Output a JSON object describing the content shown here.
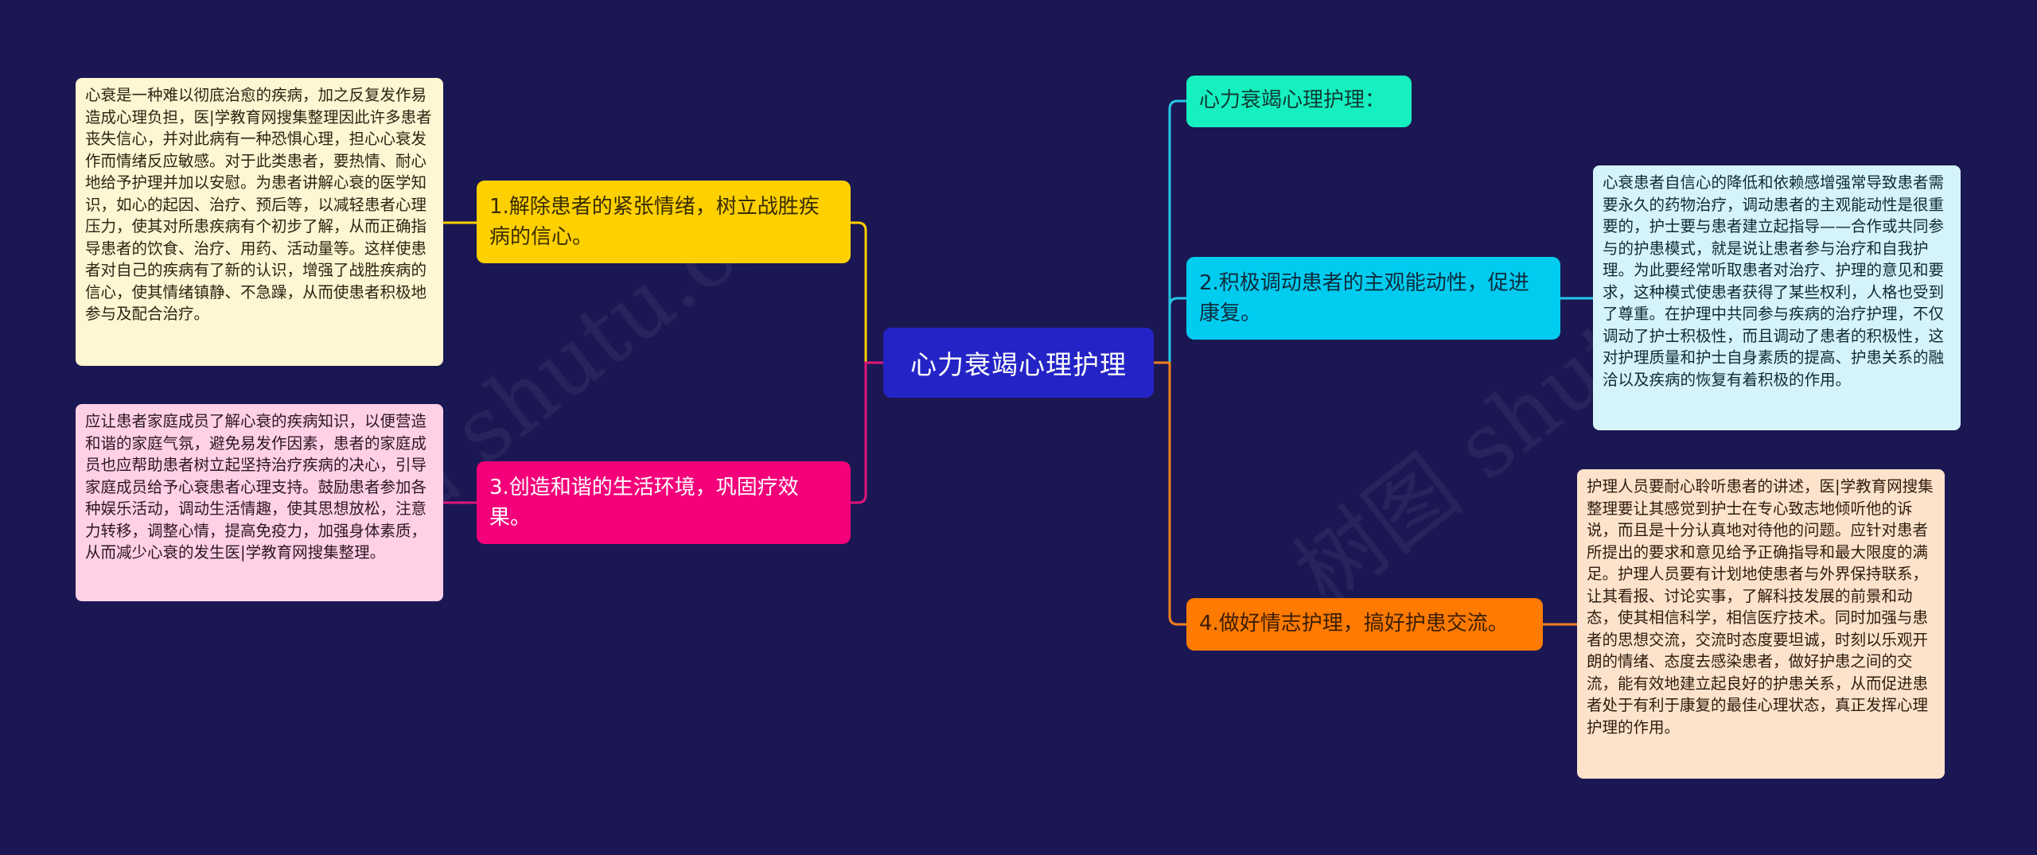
{
  "mindmap": {
    "root": {
      "label": "心力衰竭心理护理",
      "color": "#2424c6"
    },
    "branches": [
      {
        "id": "b1",
        "side": "left",
        "label": "1.解除患者的紧张情绪，树立战胜疾病的信心。",
        "color": "#ffd000",
        "note": "心衰是一种难以彻底治愈的疾病，加之反复发作易造成心理负担，医|学教育网搜集整理因此许多患者丧失信心，并对此病有一种恐惧心理，担心心衰发作而情绪反应敏感。对于此类患者，要热情、耐心地给予护理并加以安慰。为患者讲解心衰的医学知识，如心的起因、治疗、预后等，以减轻患者心理压力，使其对所患疾病有个初步了解，从而正确指导患者的饮食、治疗、用药、活动量等。这样使患者对自己的疾病有了新的认识，增强了战胜疾病的信心，使其情绪镇静、不急躁，从而使患者积极地参与及配合治疗。",
        "note_color": "#fff6d3"
      },
      {
        "id": "b3",
        "side": "left",
        "label": "3.创造和谐的生活环境，巩固疗效果。",
        "color": "#f4007a",
        "note": "应让患者家庭成员了解心衰的疾病知识，以便营造和谐的家庭气氛，避免易发作因素，患者的家庭成员也应帮助患者树立起坚持治疗疾病的决心，引导家庭成员给予心衰患者心理支持。鼓励患者参加各种娱乐活动，调动生活情趣，使其思想放松，注意力转移，调整心情，提高免疫力，加强身体素质，从而减少心衰的发生医|学教育网搜集整理。",
        "note_color": "#ffd0e6"
      },
      {
        "id": "bt",
        "side": "right",
        "label": "心力衰竭心理护理：",
        "color": "#16f0c0"
      },
      {
        "id": "b2",
        "side": "right",
        "label": "2.积极调动患者的主观能动性，促进康复。",
        "color": "#00ccf0",
        "note": "心衰患者自信心的降低和依赖感增强常导致患者需要永久的药物治疗，调动患者的主观能动性是很重要的，护士要与患者建立起指导——合作或共同参与的护患模式，就是说让患者参与治疗和自我护理。为此要经常听取患者对治疗、护理的意见和要求，这种模式使患者获得了某些权利，人格也受到了尊重。在护理中共同参与疾病的治疗护理，不仅调动了护士积极性，而且调动了患者的积极性，这对护理质量和护士自身素质的提高、护患关系的融洽以及疾病的恢复有着积极的作用。",
        "note_color": "#d5f3fb"
      },
      {
        "id": "b4",
        "side": "right",
        "label": "4.做好情志护理，搞好护患交流。",
        "color": "#ff7a00",
        "note": "护理人员要耐心聆听患者的讲述，医|学教育网搜集整理要让其感觉到护士在专心致志地倾听他的诉说，而且是十分认真地对待他的问题。应针对患者所提出的要求和意见给予正确指导和最大限度的满足。护理人员要有计划地使患者与外界保持联系，让其看报、讨论实事，了解科技发展的前景和动态，使其相信科学，相信医疗技术。同时加强与患者的思想交流，交流时态度要坦诚，时刻以乐观开朗的情绪、态度去感染患者，做好护患之间的交流，能有效地建立起良好的护患关系，从而促进患者处于有利于康复的最佳心理状态，真正发挥心理护理的作用。",
        "note_color": "#fde3cc"
      }
    ]
  },
  "watermark": {
    "text": "树图 shutu.cn"
  },
  "background_color": "#1b1752"
}
